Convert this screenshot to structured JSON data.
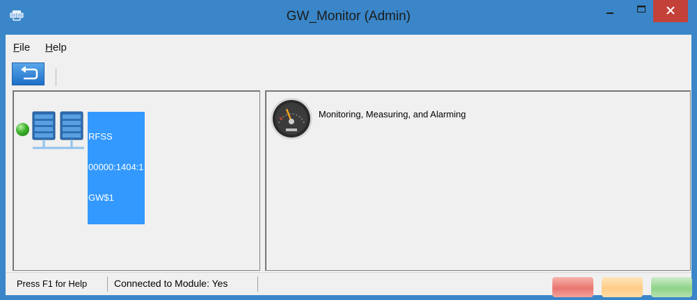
{
  "window": {
    "title": "GW_Monitor (Admin)",
    "icons": {
      "app": "app-icon",
      "minimize": "minimize-icon",
      "maximize": "maximize-icon",
      "close": "close-icon"
    },
    "colors": {
      "frame": "#3a86c8",
      "close": "#c4413a"
    }
  },
  "menu": {
    "file": "File",
    "help": "Help"
  },
  "toolbar": {
    "back_icon": "back-arrow-icon"
  },
  "left_pane": {
    "node": {
      "status_color": "#3cb12a",
      "icon": "network-servers-icon",
      "lines": [
        "RFSS",
        "00000:1404:1",
        "GW$1"
      ],
      "selection_color": "#3399ff"
    }
  },
  "right_pane": {
    "item": {
      "icon": "gauge-icon",
      "label": "Monitoring, Measuring, and Alarming"
    }
  },
  "statusbar": {
    "help_text": "Press F1 for Help",
    "connection_text": "Connected to Module: Yes",
    "indicators": [
      {
        "name": "red",
        "color": "#e8766f"
      },
      {
        "name": "yellow",
        "color": "#ffcc86"
      },
      {
        "name": "green",
        "color": "#8fd489"
      }
    ]
  }
}
